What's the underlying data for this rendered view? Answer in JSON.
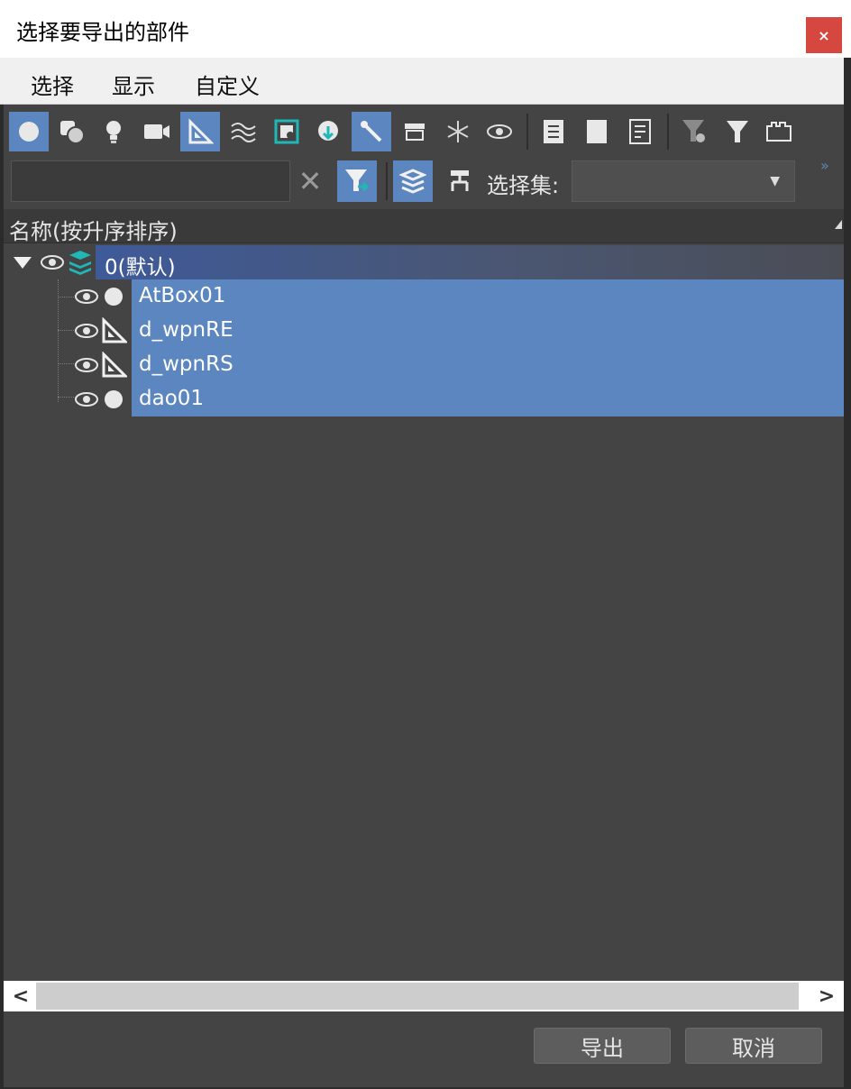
{
  "window": {
    "title": "选择要导出的部件",
    "close_label": "×"
  },
  "menu": [
    "选择",
    "显示",
    "自定义"
  ],
  "toolbar": {
    "clear_label": "✕",
    "selection_set_label": "选择集:",
    "selection_set_value": "",
    "more_label": "»"
  },
  "column_header": "名称(按升序排序)",
  "tree": {
    "layer": {
      "name": "0(默认)",
      "expanded": true
    },
    "items": [
      {
        "name": "AtBox01",
        "type": "geometry",
        "icon": "sphere-icon"
      },
      {
        "name": "d_wpnRE",
        "type": "helper",
        "icon": "set-square-icon"
      },
      {
        "name": "d_wpnRS",
        "type": "helper",
        "icon": "set-square-icon"
      },
      {
        "name": "dao01",
        "type": "geometry",
        "icon": "sphere-icon"
      }
    ]
  },
  "buttons": {
    "export": "导出",
    "cancel": "取消"
  },
  "colors": {
    "selection": "#5b86bf",
    "panel": "#444444",
    "close": "#d6473f",
    "accent": "#1fb7b7"
  }
}
